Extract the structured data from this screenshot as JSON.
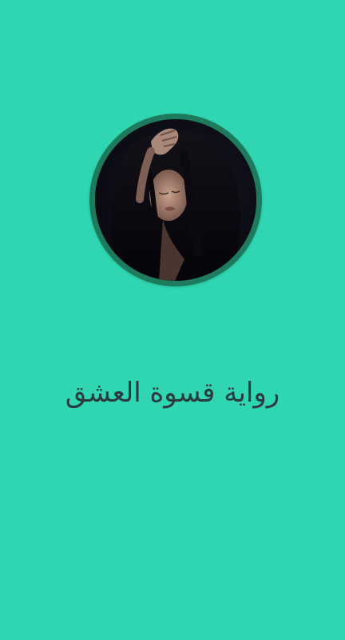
{
  "app": {
    "title": "رواية قسوة العشق"
  },
  "avatar": {
    "icon": "book-cover-portrait",
    "description": ""
  },
  "colors": {
    "background": "#2fd6b1",
    "ring": "#1e7a5c",
    "title_text": "#2b3a3e"
  }
}
